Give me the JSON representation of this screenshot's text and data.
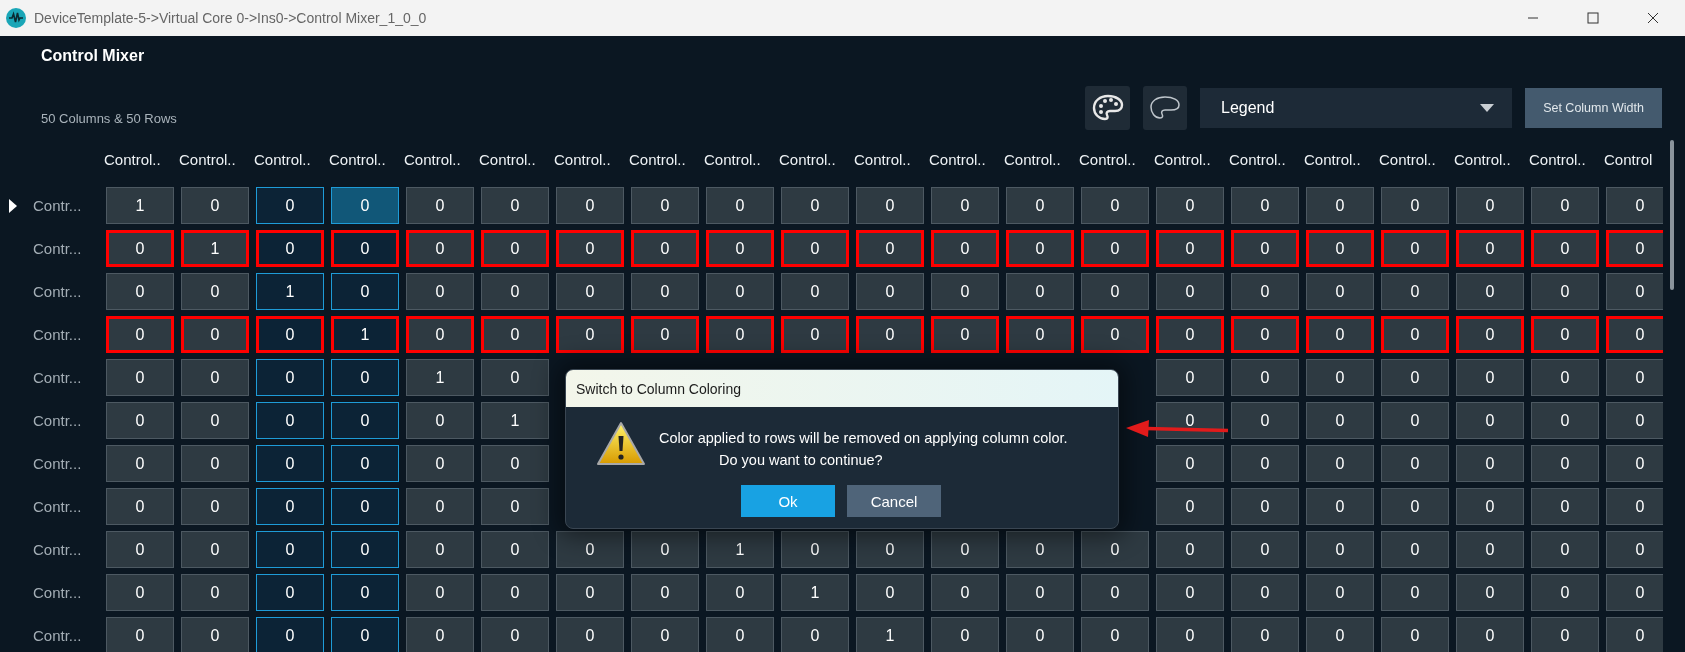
{
  "window": {
    "title": "DeviceTemplate-5->Virtual Core 0->Ins0->Control Mixer_1_0_0"
  },
  "panel": {
    "title": "Control Mixer",
    "summary": "50 Columns & 50 Rows"
  },
  "toolbar": {
    "legend": {
      "value": "Legend"
    },
    "set_width_button": "Set Column Width"
  },
  "grid": {
    "columns": [
      {
        "header": "Control..",
        "colored": false,
        "selected": false
      },
      {
        "header": "Control..",
        "colored": false,
        "selected": false
      },
      {
        "header": "Control..",
        "colored": true,
        "selected": false
      },
      {
        "header": "Control..",
        "colored": true,
        "selected": true
      },
      {
        "header": "Control..",
        "colored": false,
        "selected": false
      },
      {
        "header": "Control..",
        "colored": false,
        "selected": false
      },
      {
        "header": "Control..",
        "colored": false,
        "selected": false
      },
      {
        "header": "Control..",
        "colored": false,
        "selected": false
      },
      {
        "header": "Control..",
        "colored": false,
        "selected": false
      },
      {
        "header": "Control..",
        "colored": false,
        "selected": false
      },
      {
        "header": "Control..",
        "colored": false,
        "selected": false
      },
      {
        "header": "Control..",
        "colored": false,
        "selected": false
      },
      {
        "header": "Control..",
        "colored": false,
        "selected": false
      },
      {
        "header": "Control..",
        "colored": false,
        "selected": false
      },
      {
        "header": "Control..",
        "colored": false,
        "selected": false
      },
      {
        "header": "Control..",
        "colored": false,
        "selected": false
      },
      {
        "header": "Control..",
        "colored": false,
        "selected": false
      },
      {
        "header": "Control..",
        "colored": false,
        "selected": false
      },
      {
        "header": "Control..",
        "colored": false,
        "selected": false
      },
      {
        "header": "Control..",
        "colored": false,
        "selected": false
      },
      {
        "header": "Control",
        "colored": false,
        "selected": false
      }
    ],
    "rows": [
      {
        "label": "Contr...",
        "current": true,
        "highlighted": false,
        "values": [
          "1",
          "0",
          "0",
          "0",
          "0",
          "0",
          "0",
          "0",
          "0",
          "0",
          "0",
          "0",
          "0",
          "0",
          "0",
          "0",
          "0",
          "0",
          "0",
          "0",
          "0"
        ]
      },
      {
        "label": "Contr...",
        "current": false,
        "highlighted": true,
        "values": [
          "0",
          "1",
          "0",
          "0",
          "0",
          "0",
          "0",
          "0",
          "0",
          "0",
          "0",
          "0",
          "0",
          "0",
          "0",
          "0",
          "0",
          "0",
          "0",
          "0",
          "0"
        ]
      },
      {
        "label": "Contr...",
        "current": false,
        "highlighted": false,
        "values": [
          "0",
          "0",
          "1",
          "0",
          "0",
          "0",
          "0",
          "0",
          "0",
          "0",
          "0",
          "0",
          "0",
          "0",
          "0",
          "0",
          "0",
          "0",
          "0",
          "0",
          "0"
        ]
      },
      {
        "label": "Contr...",
        "current": false,
        "highlighted": true,
        "values": [
          "0",
          "0",
          "0",
          "1",
          "0",
          "0",
          "0",
          "0",
          "0",
          "0",
          "0",
          "0",
          "0",
          "0",
          "0",
          "0",
          "0",
          "0",
          "0",
          "0",
          "0"
        ]
      },
      {
        "label": "Contr...",
        "current": false,
        "highlighted": false,
        "kind": "split",
        "values_before": [
          "0",
          "0",
          "0",
          "0",
          "1",
          "0"
        ],
        "values_after": [
          "0",
          "0",
          "0",
          "0",
          "0",
          "0",
          "0"
        ]
      },
      {
        "label": "Contr...",
        "current": false,
        "highlighted": false,
        "kind": "split",
        "values_before": [
          "0",
          "0",
          "0",
          "0",
          "0",
          "1"
        ],
        "values_after": [
          "0",
          "0",
          "0",
          "0",
          "0",
          "0",
          "0"
        ]
      },
      {
        "label": "Contr...",
        "current": false,
        "highlighted": false,
        "kind": "split",
        "values_before": [
          "0",
          "0",
          "0",
          "0",
          "0",
          "0"
        ],
        "values_after": [
          "0",
          "0",
          "0",
          "0",
          "0",
          "0",
          "0"
        ]
      },
      {
        "label": "Contr...",
        "current": false,
        "highlighted": false,
        "kind": "split",
        "values_before": [
          "0",
          "0",
          "0",
          "0",
          "0",
          "0"
        ],
        "values_after": [
          "0",
          "0",
          "0",
          "0",
          "0",
          "0",
          "0"
        ]
      },
      {
        "label": "Contr...",
        "current": false,
        "highlighted": false,
        "values": [
          "0",
          "0",
          "0",
          "0",
          "0",
          "0",
          "0",
          "0",
          "1",
          "0",
          "0",
          "0",
          "0",
          "0",
          "0",
          "0",
          "0",
          "0",
          "0",
          "0",
          "0"
        ]
      },
      {
        "label": "Contr...",
        "current": false,
        "highlighted": false,
        "values": [
          "0",
          "0",
          "0",
          "0",
          "0",
          "0",
          "0",
          "0",
          "0",
          "1",
          "0",
          "0",
          "0",
          "0",
          "0",
          "0",
          "0",
          "0",
          "0",
          "0",
          "0"
        ]
      },
      {
        "label": "Contr...",
        "current": false,
        "highlighted": false,
        "values": [
          "0",
          "0",
          "0",
          "0",
          "0",
          "0",
          "0",
          "0",
          "0",
          "0",
          "1",
          "0",
          "0",
          "0",
          "0",
          "0",
          "0",
          "0",
          "0",
          "0",
          "0"
        ]
      }
    ]
  },
  "dialog": {
    "title": "Switch to Column Coloring",
    "message_lines": [
      "Color applied to rows will be removed on applying column color.",
      "Do you want to continue?"
    ],
    "buttons": [
      {
        "label": "Ok",
        "kind": "primary"
      },
      {
        "label": "Cancel",
        "kind": "secondary"
      }
    ]
  }
}
